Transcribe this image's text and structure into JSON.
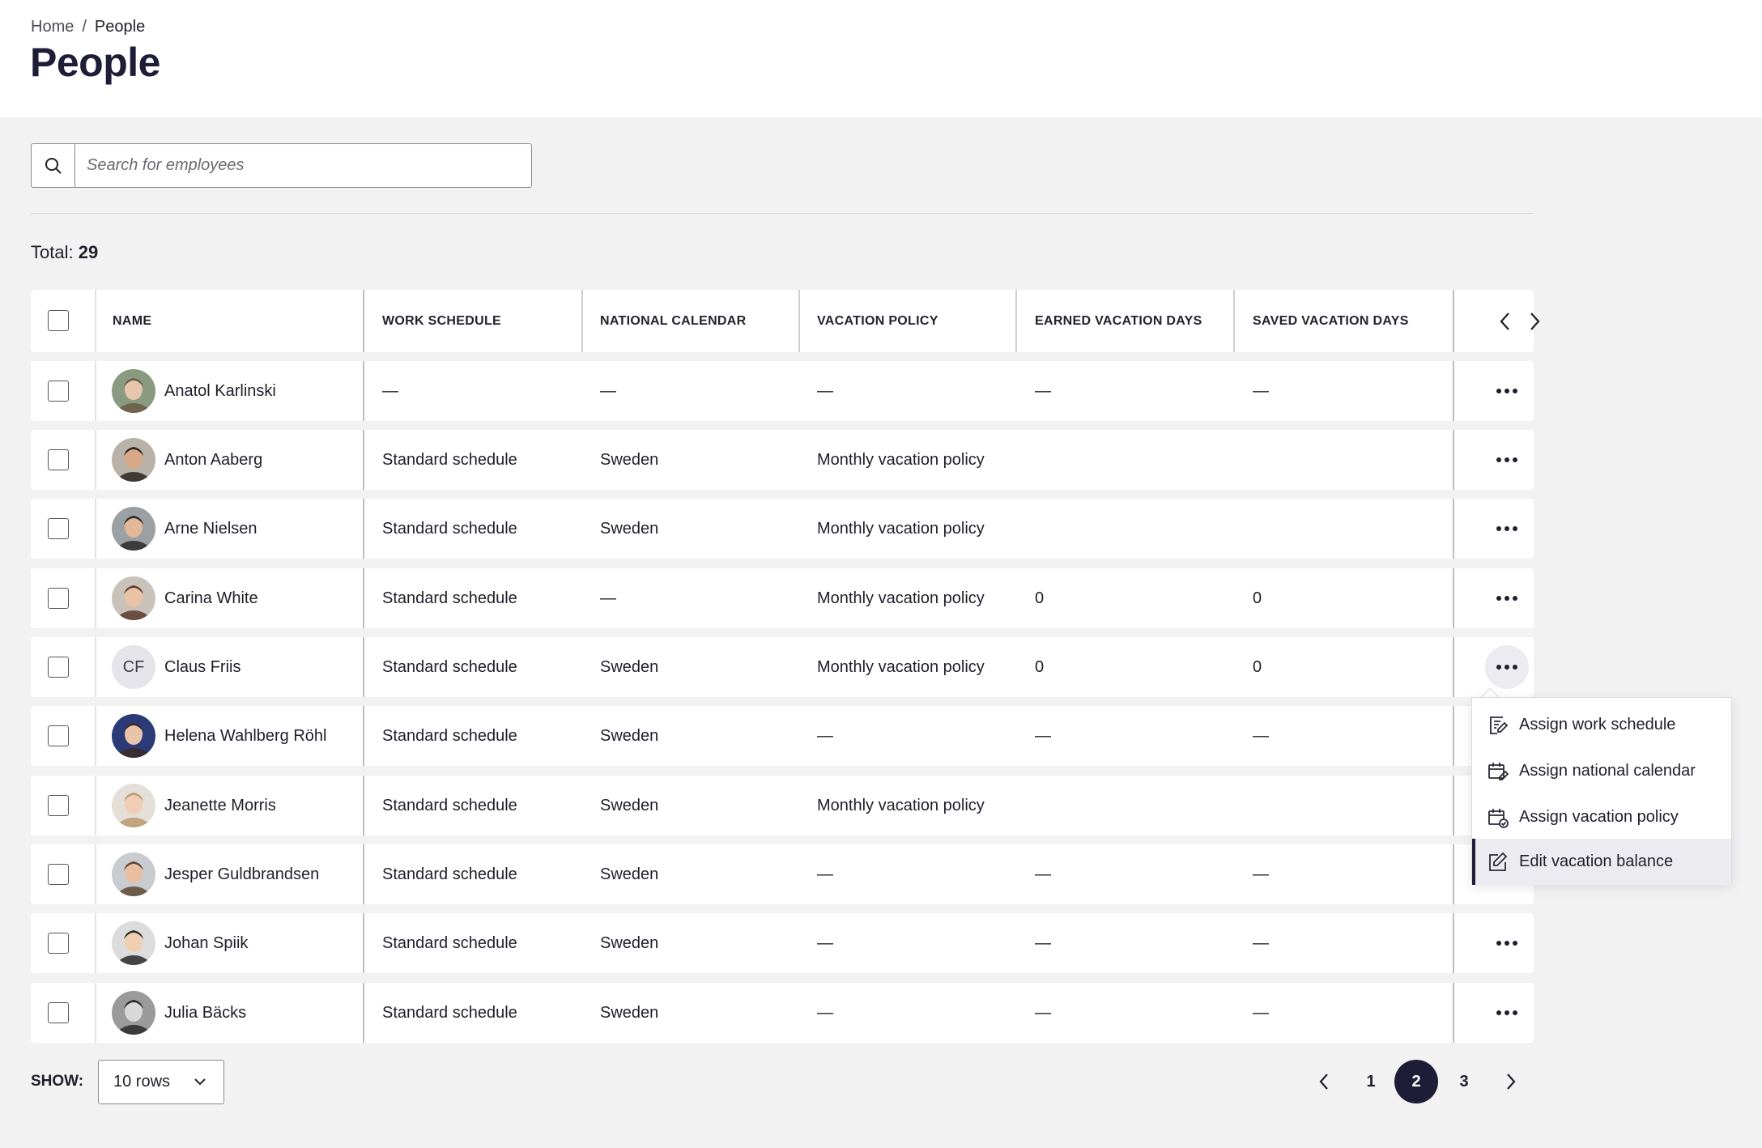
{
  "breadcrumb": {
    "home": "Home",
    "separator": "/",
    "current": "People"
  },
  "page_title": "People",
  "search": {
    "placeholder": "Search for employees",
    "value": ""
  },
  "total": {
    "label": "Total:",
    "count": "29"
  },
  "table": {
    "columns": [
      "NAME",
      "WORK SCHEDULE",
      "NATIONAL CALENDAR",
      "VACATION POLICY",
      "EARNED VACATION DAYS",
      "SAVED VACATION DAYS"
    ],
    "rows": [
      {
        "name": "Anatol Karlinski",
        "avatar": "photo",
        "initials": "",
        "schedule": "—",
        "calendar": "—",
        "policy": "—",
        "earned": "—",
        "saved": "—"
      },
      {
        "name": "Anton Aaberg",
        "avatar": "photo",
        "initials": "",
        "schedule": "Standard schedule",
        "calendar": "Sweden",
        "policy": "Monthly vacation policy",
        "earned": "",
        "saved": ""
      },
      {
        "name": "Arne Nielsen",
        "avatar": "photo",
        "initials": "",
        "schedule": "Standard schedule",
        "calendar": "Sweden",
        "policy": "Monthly vacation policy",
        "earned": "",
        "saved": ""
      },
      {
        "name": "Carina White",
        "avatar": "photo",
        "initials": "",
        "schedule": "Standard schedule",
        "calendar": "—",
        "policy": "Monthly vacation policy",
        "earned": "0",
        "saved": "0"
      },
      {
        "name": "Claus Friis",
        "avatar": "initials",
        "initials": "CF",
        "schedule": "Standard schedule",
        "calendar": "Sweden",
        "policy": "Monthly vacation policy",
        "earned": "0",
        "saved": "0"
      },
      {
        "name": "Helena Wahlberg Röhl",
        "avatar": "photo",
        "initials": "",
        "schedule": "Standard schedule",
        "calendar": "Sweden",
        "policy": "—",
        "earned": "—",
        "saved": "—"
      },
      {
        "name": "Jeanette Morris",
        "avatar": "photo",
        "initials": "",
        "schedule": "Standard schedule",
        "calendar": "Sweden",
        "policy": "Monthly vacation policy",
        "earned": "",
        "saved": ""
      },
      {
        "name": "Jesper Guldbrandsen",
        "avatar": "photo",
        "initials": "",
        "schedule": "Standard schedule",
        "calendar": "Sweden",
        "policy": "—",
        "earned": "—",
        "saved": "—"
      },
      {
        "name": "Johan Spiik",
        "avatar": "photo",
        "initials": "",
        "schedule": "Standard schedule",
        "calendar": "Sweden",
        "policy": "—",
        "earned": "—",
        "saved": "—"
      },
      {
        "name": "Julia Bäcks",
        "avatar": "photo",
        "initials": "",
        "schedule": "Standard schedule",
        "calendar": "Sweden",
        "policy": "—",
        "earned": "—",
        "saved": "—"
      }
    ]
  },
  "row_menu": {
    "open_for": "Claus Friis",
    "items": [
      {
        "label": "Assign work schedule",
        "icon": "schedule-edit-icon"
      },
      {
        "label": "Assign national calendar",
        "icon": "calendar-edit-icon"
      },
      {
        "label": "Assign vacation policy",
        "icon": "calendar-check-icon"
      },
      {
        "label": "Edit vacation balance",
        "icon": "edit-icon",
        "highlighted": true
      }
    ]
  },
  "footer": {
    "show_label": "SHOW:",
    "rows_per_page": "10 rows",
    "pages": [
      "1",
      "2",
      "3"
    ],
    "current_page": "2"
  },
  "colors": {
    "accent": "#1d1d38",
    "background": "#f2f2f3",
    "surface": "#ffffff"
  }
}
